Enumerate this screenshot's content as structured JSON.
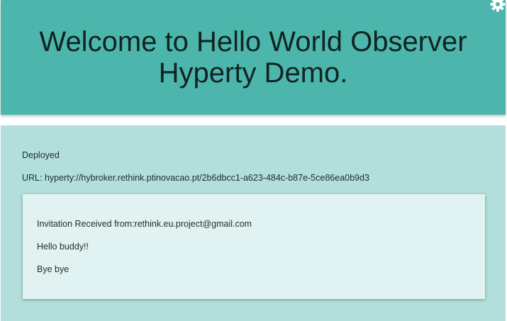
{
  "header": {
    "title_line1": "Welcome to Hello World Observer",
    "title_line2": "Hyperty Demo.",
    "settings_icon": "gear-icon"
  },
  "status": {
    "deployed": "Deployed",
    "url": "URL: hyperty://hybroker.rethink.ptinovacao.pt/2b6dbcc1-a623-484c-b87e-5ce86ea0b9d3"
  },
  "card": {
    "invitation": "Invitation Received from:rethink.eu.project@gmail.com",
    "message1": "Hello buddy!!",
    "message2": "Bye bye"
  },
  "colors": {
    "header": "#4db6ac",
    "main": "#b2dfdb",
    "card": "#e0f2f1"
  }
}
